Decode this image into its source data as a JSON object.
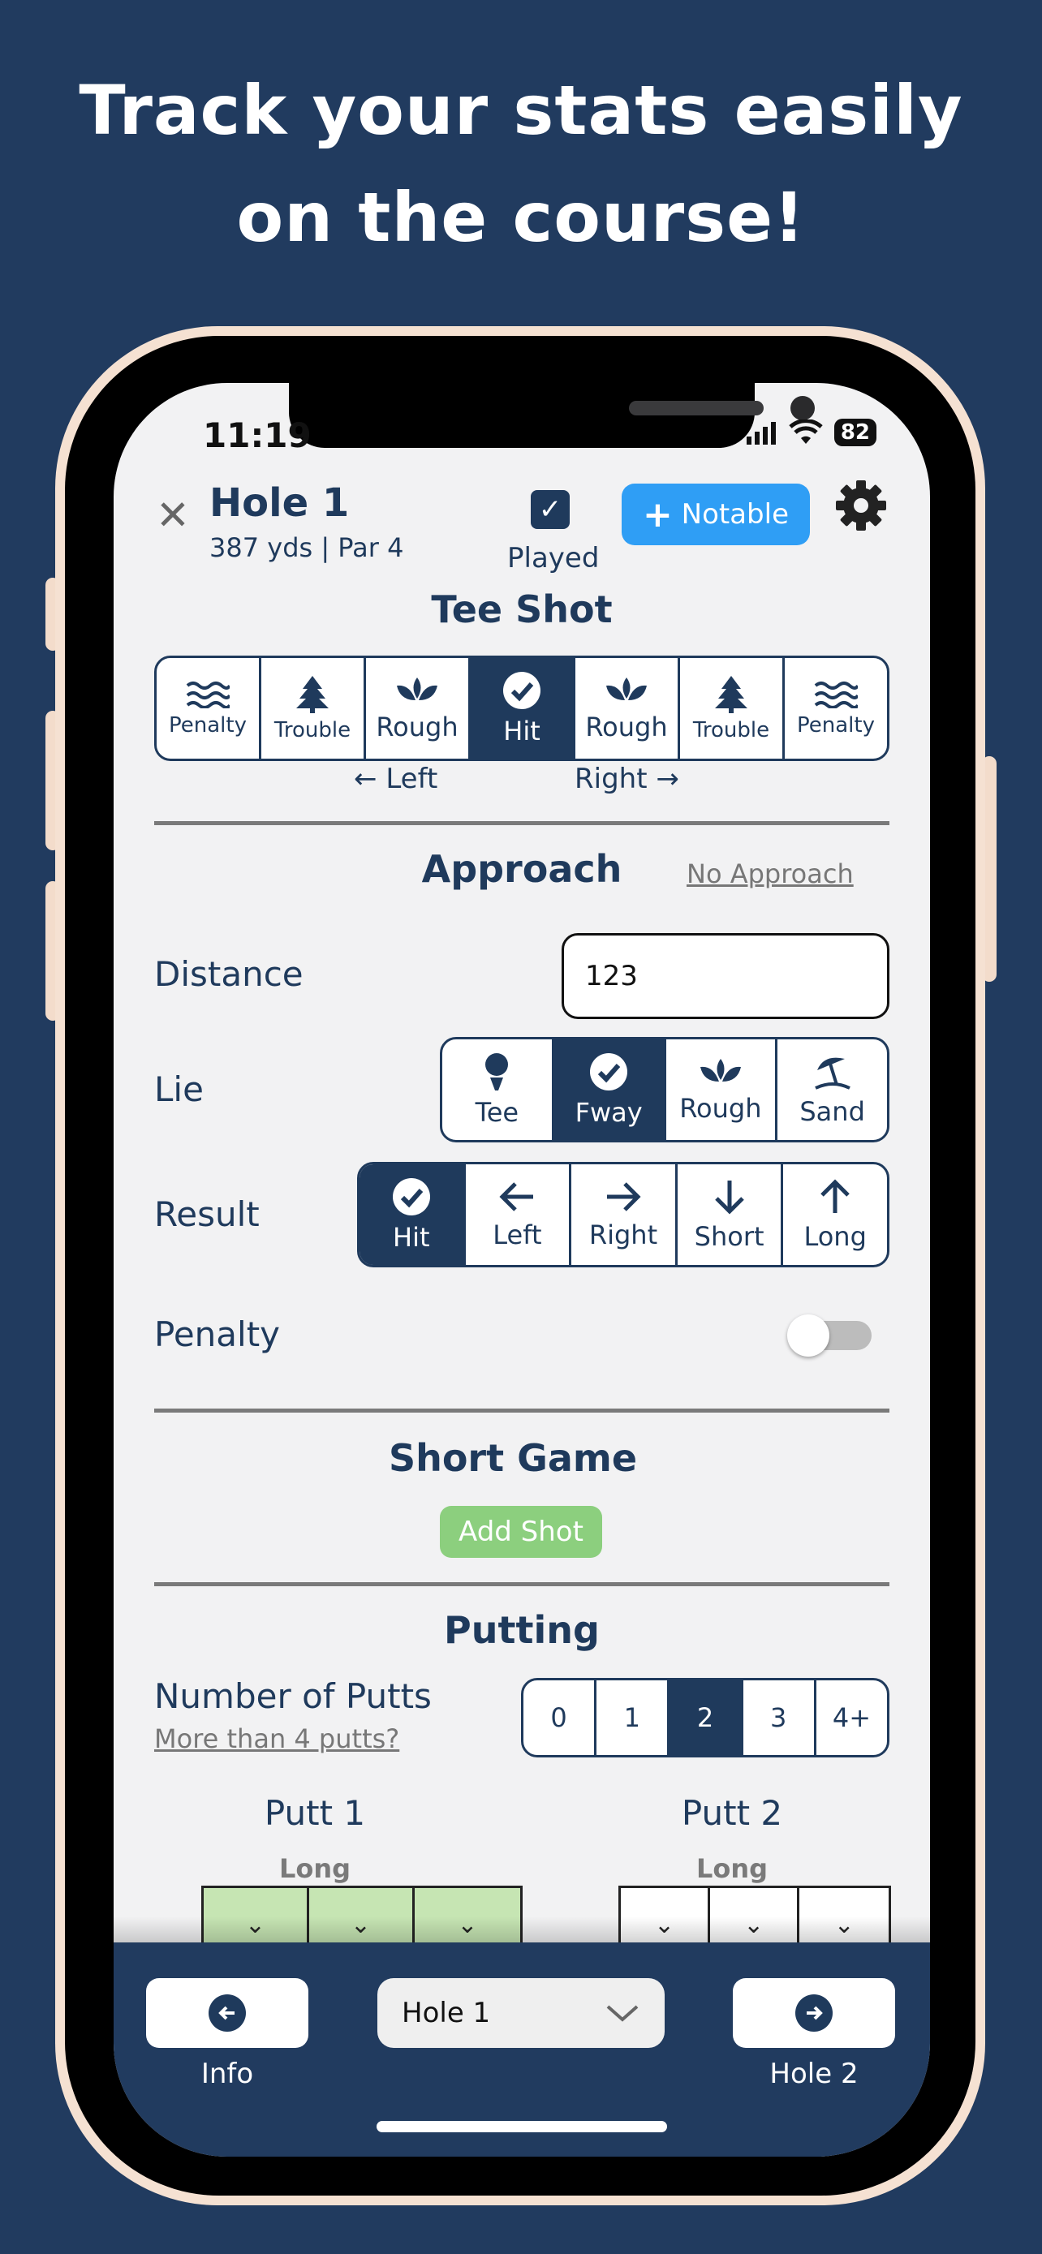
{
  "headline": {
    "line1": "Track your stats easily",
    "line2": "on the course!"
  },
  "status_bar": {
    "time": "11:19",
    "battery": "82"
  },
  "header": {
    "hole_title": "Hole 1",
    "hole_subtitle": "387 yds | Par 4",
    "played_label": "Played",
    "notable_label": "Notable",
    "notable_plus": "+"
  },
  "tee_shot": {
    "title": "Tee Shot",
    "options": [
      {
        "label": "Penalty",
        "icon": "water-waves-icon"
      },
      {
        "label": "Trouble",
        "icon": "pine-tree-icon"
      },
      {
        "label": "Rough",
        "icon": "leaves-icon"
      },
      {
        "label": "Hit",
        "icon": "check-circle-icon",
        "selected": true
      },
      {
        "label": "Rough",
        "icon": "leaves-icon"
      },
      {
        "label": "Trouble",
        "icon": "pine-tree-icon"
      },
      {
        "label": "Penalty",
        "icon": "water-waves-icon"
      }
    ],
    "left_label": "Left",
    "right_label": "Right"
  },
  "approach": {
    "title": "Approach",
    "no_approach_link": "No Approach",
    "distance_label": "Distance",
    "distance_value": "123",
    "lie_label": "Lie",
    "lie_options": [
      {
        "label": "Tee",
        "icon": "golf-tee-icon"
      },
      {
        "label": "Fway",
        "icon": "check-circle-icon",
        "selected": true
      },
      {
        "label": "Rough",
        "icon": "leaves-icon"
      },
      {
        "label": "Sand",
        "icon": "beach-umbrella-icon"
      }
    ],
    "result_label": "Result",
    "result_options": [
      {
        "label": "Hit",
        "icon": "check-circle-icon",
        "selected": true
      },
      {
        "label": "Left",
        "icon": "arrow-left-icon"
      },
      {
        "label": "Right",
        "icon": "arrow-right-icon"
      },
      {
        "label": "Short",
        "icon": "arrow-down-icon"
      },
      {
        "label": "Long",
        "icon": "arrow-up-icon"
      }
    ],
    "penalty_label": "Penalty"
  },
  "short_game": {
    "title": "Short Game",
    "add_shot_label": "Add Shot"
  },
  "putting": {
    "title": "Putting",
    "num_putts_label": "Number of Putts",
    "more_link": "More than 4 putts?",
    "options": [
      "0",
      "1",
      "2",
      "3",
      "4+"
    ],
    "selected_index": 2,
    "putt1_title": "Putt 1",
    "putt1_sub": "Long",
    "putt2_title": "Putt 2",
    "putt2_sub": "Long"
  },
  "bottom_nav": {
    "info_label": "Info",
    "hole_select_value": "Hole 1",
    "next_label": "Hole 2"
  },
  "colors": {
    "navy": "#1f3a5c",
    "accent_blue": "#2f9ef5",
    "green": "#8ccf7e",
    "putt_green": "#c6e5b3"
  }
}
